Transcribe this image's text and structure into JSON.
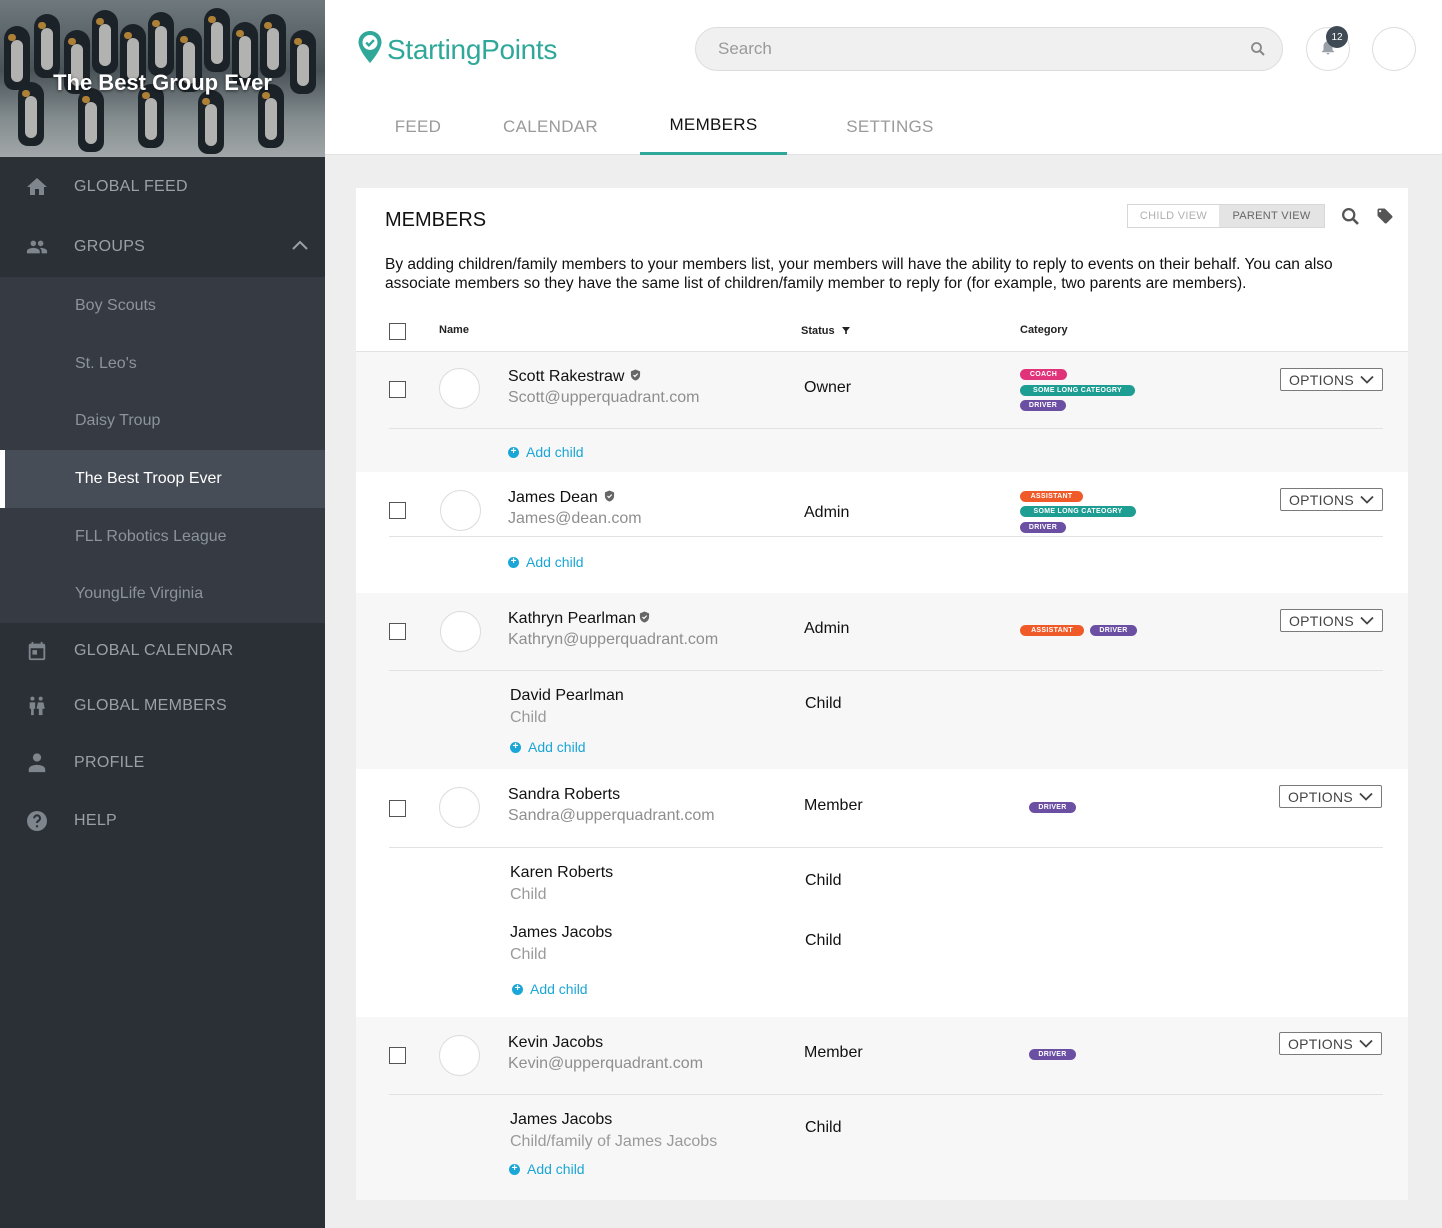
{
  "group": {
    "title": "The Best Group Ever"
  },
  "nav": {
    "global_feed": "GLOBAL FEED",
    "groups": "GROUPS",
    "subgroups": [
      "Boy Scouts",
      "St. Leo's",
      "Daisy Troup",
      "The Best Troop Ever",
      "FLL Robotics League",
      "YoungLife Virginia"
    ],
    "active_subgroup": "The Best Troop Ever",
    "global_calendar": "GLOBAL CALENDAR",
    "global_members": "GLOBAL MEMBERS",
    "profile": "PROFILE",
    "help": "HELP"
  },
  "header": {
    "logo": "StartingPoints",
    "search_placeholder": "Search",
    "notification_count": "12",
    "tabs": [
      "FEED",
      "CALENDAR",
      "MEMBERS",
      "SETTINGS"
    ],
    "active_tab": "MEMBERS"
  },
  "colors": {
    "brand": "#2fa89a",
    "link": "#1aa6d6",
    "sidebar": "#2b2f36"
  },
  "members": {
    "title": "MEMBERS",
    "view_toggle": {
      "child": "CHILD VIEW",
      "parent": "PARENT VIEW",
      "selected": "PARENT VIEW"
    },
    "description": "By adding children/family members to your members list, your members will have the ability to reply to events on their behalf. You can also associate members so they have the same list of children/family member to reply for (for example, two parents are members).",
    "columns": {
      "name": "Name",
      "status": "Status",
      "category": "Category"
    },
    "options_label": "OPTIONS",
    "add_child_label": "Add child",
    "rows": [
      {
        "name": "Scott Rakestraw",
        "email": "Scott@upperquadrant.com",
        "status": "Owner",
        "verified": true,
        "categories": [
          "COACH",
          "SOME LONG CATEOGRY",
          "DRIVER"
        ],
        "children": []
      },
      {
        "name": "James Dean",
        "email": "James@dean.com",
        "status": "Admin",
        "verified": true,
        "categories": [
          "ASSISTANT",
          "SOME LONG CATEOGRY",
          "DRIVER"
        ],
        "children": []
      },
      {
        "name": "Kathryn Pearlman",
        "email": "Kathryn@upperquadrant.com",
        "status": "Admin",
        "verified": true,
        "categories": [
          "ASSISTANT",
          "DRIVER"
        ],
        "children": [
          {
            "name": "David Pearlman",
            "role": "Child",
            "status": "Child"
          }
        ]
      },
      {
        "name": "Sandra Roberts",
        "email": "Sandra@upperquadrant.com",
        "status": "Member",
        "verified": false,
        "categories": [
          "DRIVER"
        ],
        "children": [
          {
            "name": "Karen Roberts",
            "role": "Child",
            "status": "Child"
          },
          {
            "name": "James Jacobs",
            "role": "Child",
            "status": "Child"
          }
        ]
      },
      {
        "name": "Kevin Jacobs",
        "email": "Kevin@upperquadrant.com",
        "status": "Member",
        "verified": false,
        "categories": [
          "DRIVER"
        ],
        "children": [
          {
            "name": "James Jacobs",
            "role": "Child/family of James Jacobs",
            "status": "Child"
          }
        ]
      }
    ]
  }
}
